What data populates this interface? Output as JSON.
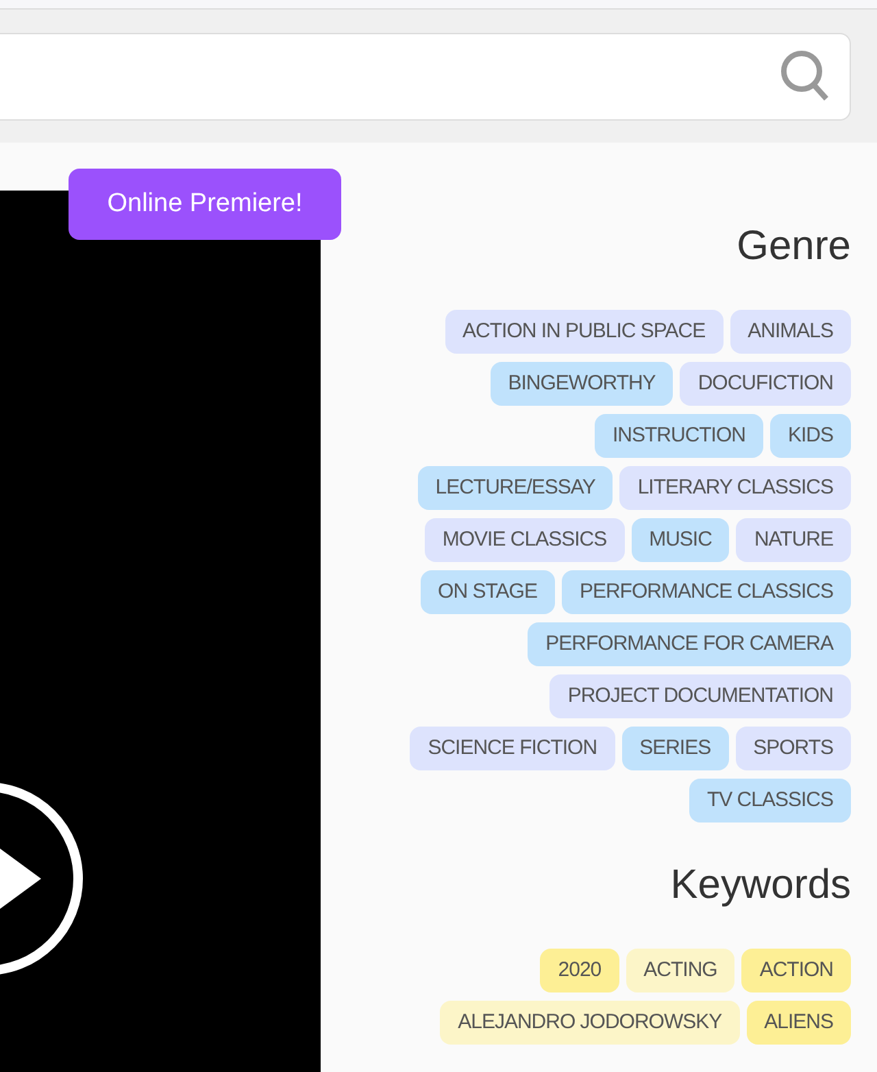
{
  "video": {
    "badge": "Online Premiere!"
  },
  "genre": {
    "title": "Genre",
    "tags": [
      {
        "label": "ACTION IN PUBLIC SPACE",
        "color": "#dde3fd"
      },
      {
        "label": "ANIMALS",
        "color": "#dde3fd"
      },
      {
        "label": "BINGEWORTHY",
        "color": "#c0e2fc"
      },
      {
        "label": "DOCUFICTION",
        "color": "#dde3fd"
      },
      {
        "label": "INSTRUCTION",
        "color": "#c0e2fc"
      },
      {
        "label": "KIDS",
        "color": "#c0e2fc"
      },
      {
        "label": "LECTURE/ESSAY",
        "color": "#c0e2fc"
      },
      {
        "label": "LITERARY CLASSICS",
        "color": "#dde3fd"
      },
      {
        "label": "MOVIE CLASSICS",
        "color": "#dde3fd"
      },
      {
        "label": "MUSIC",
        "color": "#c0e2fc"
      },
      {
        "label": "NATURE",
        "color": "#dde3fd"
      },
      {
        "label": "ON STAGE",
        "color": "#c0e2fc"
      },
      {
        "label": "PERFORMANCE CLASSICS",
        "color": "#c0e2fc"
      },
      {
        "label": "PERFORMANCE FOR CAMERA",
        "color": "#c0e2fc"
      },
      {
        "label": "PROJECT DOCUMENTATION",
        "color": "#dde3fd"
      },
      {
        "label": "SCIENCE FICTION",
        "color": "#dde3fd"
      },
      {
        "label": "SERIES",
        "color": "#c0e2fc"
      },
      {
        "label": "SPORTS",
        "color": "#dde3fd"
      },
      {
        "label": "TV CLASSICS",
        "color": "#c0e2fc"
      }
    ]
  },
  "keywords": {
    "title": "Keywords",
    "tags": [
      {
        "label": "2020",
        "color": "#fdef95"
      },
      {
        "label": "ACTING",
        "color": "#fcf5c8"
      },
      {
        "label": "ACTION",
        "color": "#fdef95"
      },
      {
        "label": "ALEJANDRO JODOROWSKY",
        "color": "#fcf5c8"
      },
      {
        "label": "ALIENS",
        "color": "#fdef95"
      }
    ]
  }
}
